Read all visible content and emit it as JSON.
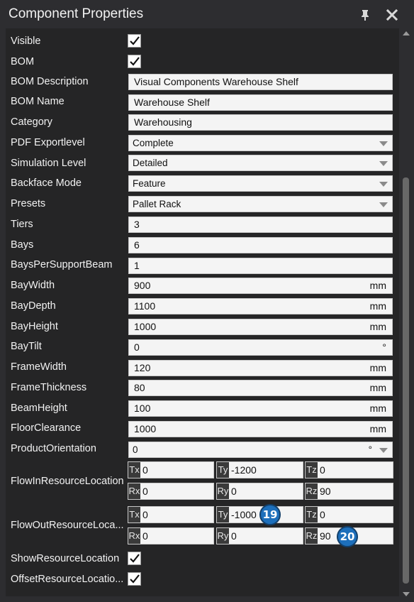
{
  "window": {
    "title": "Component Properties",
    "pin_icon": "pin-icon",
    "close_icon": "close-icon"
  },
  "properties": {
    "visible": {
      "label": "Visible",
      "checked": true
    },
    "bom": {
      "label": "BOM",
      "checked": true
    },
    "bom_description": {
      "label": "BOM Description",
      "value": "Visual Components Warehouse Shelf"
    },
    "bom_name": {
      "label": "BOM Name",
      "value": "Warehouse Shelf"
    },
    "category": {
      "label": "Category",
      "value": "Warehousing"
    },
    "pdf_exportlevel": {
      "label": "PDF Exportlevel",
      "value": "Complete"
    },
    "simulation_level": {
      "label": "Simulation Level",
      "value": "Detailed"
    },
    "backface_mode": {
      "label": "Backface Mode",
      "value": "Feature"
    },
    "presets": {
      "label": "Presets",
      "value": "Pallet Rack"
    },
    "tiers": {
      "label": "Tiers",
      "value": "3"
    },
    "bays": {
      "label": "Bays",
      "value": "6"
    },
    "bays_per_support_beam": {
      "label": "BaysPerSupportBeam",
      "value": "1"
    },
    "bay_width": {
      "label": "BayWidth",
      "value": "900",
      "unit": "mm"
    },
    "bay_depth": {
      "label": "BayDepth",
      "value": "1100",
      "unit": "mm"
    },
    "bay_height": {
      "label": "BayHeight",
      "value": "1000",
      "unit": "mm"
    },
    "bay_tilt": {
      "label": "BayTilt",
      "value": "0",
      "unit": "°"
    },
    "frame_width": {
      "label": "FrameWidth",
      "value": "120",
      "unit": "mm"
    },
    "frame_thickness": {
      "label": "FrameThickness",
      "value": "80",
      "unit": "mm"
    },
    "beam_height": {
      "label": "BeamHeight",
      "value": "100",
      "unit": "mm"
    },
    "floor_clearance": {
      "label": "FloorClearance",
      "value": "1000",
      "unit": "mm"
    },
    "product_orientation": {
      "label": "ProductOrientation",
      "value": "0",
      "unit": "°"
    },
    "flow_in": {
      "label": "FlowInResourceLocation",
      "tx": {
        "tag": "Tx",
        "value": "0"
      },
      "ty": {
        "tag": "Ty",
        "value": "-1200"
      },
      "tz": {
        "tag": "Tz",
        "value": "0"
      },
      "rx": {
        "tag": "Rx",
        "value": "0"
      },
      "ry": {
        "tag": "Ry",
        "value": "0"
      },
      "rz": {
        "tag": "Rz",
        "value": "90"
      }
    },
    "flow_out": {
      "label": "FlowOutResourceLoca...",
      "tx": {
        "tag": "Tx",
        "value": "0"
      },
      "ty": {
        "tag": "Ty",
        "value": "-1000"
      },
      "tz": {
        "tag": "Tz",
        "value": "0"
      },
      "rx": {
        "tag": "Rx",
        "value": "0"
      },
      "ry": {
        "tag": "Ry",
        "value": "0"
      },
      "rz": {
        "tag": "Rz",
        "value": "90"
      }
    },
    "show_resource_location": {
      "label": "ShowResourceLocation",
      "checked": true
    },
    "offset_resource_location": {
      "label": "OffsetResourceLocatio...",
      "checked": true
    }
  },
  "badges": {
    "ty_badge": "19",
    "rz_badge": "20",
    "color": "#1d6fbb"
  }
}
